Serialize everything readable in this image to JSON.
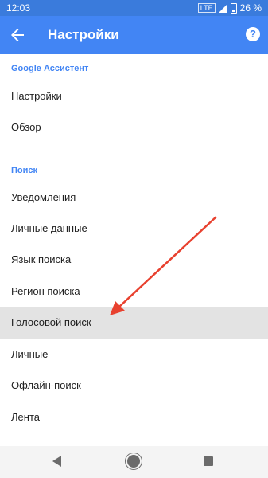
{
  "status_bar": {
    "time": "12:03",
    "network": "LTE",
    "battery": "26 %"
  },
  "app_bar": {
    "title": "Настройки"
  },
  "sections": [
    {
      "header": "Google Ассистент",
      "items": [
        "Настройки",
        "Обзор"
      ]
    },
    {
      "header": "Поиск",
      "items": [
        "Уведомления",
        "Личные данные",
        "Язык поиска",
        "Регион поиска",
        "Голосовой поиск",
        "Личные",
        "Офлайн-поиск",
        "Лента"
      ]
    }
  ],
  "selected_item": "Голосовой поиск",
  "colors": {
    "accent": "#4285f4",
    "status_bar": "#3a7bdc",
    "annotation_arrow": "#e8412f",
    "selected_row": "#e3e3e3"
  },
  "icons": [
    "back-arrow-icon",
    "help-icon",
    "signal-icon",
    "battery-icon",
    "nav-back-icon",
    "nav-home-icon",
    "nav-recents-icon"
  ]
}
